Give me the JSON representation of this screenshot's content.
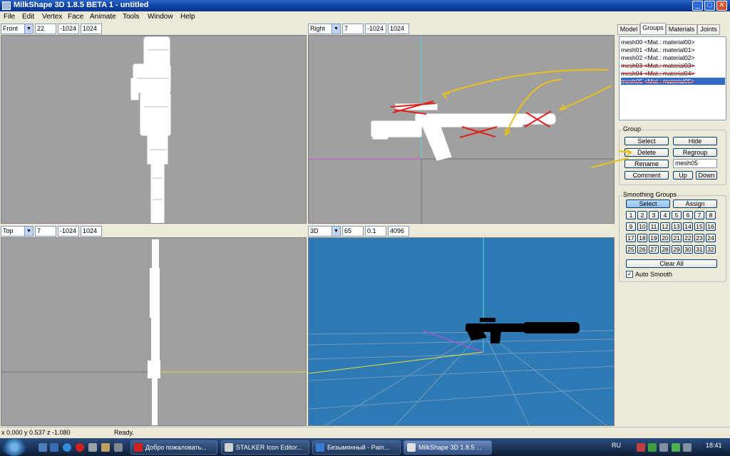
{
  "window": {
    "title": "MilkShape 3D 1.8.5 BETA 1 - untitled",
    "minimize": "_",
    "maximize": "□",
    "close": "✕"
  },
  "menu": [
    "File",
    "Edit",
    "Vertex",
    "Face",
    "Animate",
    "Tools",
    "Window",
    "Help"
  ],
  "viewports": {
    "front": {
      "view": "Front",
      "v1": "22",
      "v2": "-1024",
      "v3": "1024"
    },
    "right": {
      "view": "Right",
      "v1": "7",
      "v2": "-1024",
      "v3": "1024"
    },
    "top": {
      "view": "Top",
      "v1": "7",
      "v2": "-1024",
      "v3": "1024"
    },
    "persp": {
      "view": "3D",
      "v1": "65",
      "v2": "0.1",
      "v3": "4096"
    }
  },
  "tabs": [
    "Model",
    "Groups",
    "Materials",
    "Joints"
  ],
  "groups": [
    {
      "name": "mesh00 <Mat.: material00>",
      "struck": false,
      "selected": false
    },
    {
      "name": "mesh01 <Mat.: material01>",
      "struck": false,
      "selected": false
    },
    {
      "name": "mesh02 <Mat.: material02>",
      "struck": false,
      "selected": false
    },
    {
      "name": "mesh03 <Mat.: material03>",
      "struck": true,
      "selected": false
    },
    {
      "name": "mesh04 <Mat.: material04>",
      "struck": true,
      "selected": false
    },
    {
      "name": "mesh05 <Mat.: material05>",
      "struck": true,
      "selected": true
    }
  ],
  "group_box": {
    "label": "Group",
    "select": "Select",
    "hide": "Hide",
    "delete": "Delete",
    "regroup": "Regroup",
    "rename": "Rename",
    "name_value": "mesh05",
    "comment": "Comment",
    "up": "Up",
    "down": "Down"
  },
  "smoothing": {
    "label": "Smoothing Groups",
    "select": "Select",
    "assign": "Assign",
    "numbers": [
      "1",
      "2",
      "3",
      "4",
      "5",
      "6",
      "7",
      "8",
      "9",
      "10",
      "11",
      "12",
      "13",
      "14",
      "15",
      "16",
      "17",
      "18",
      "19",
      "20",
      "21",
      "22",
      "23",
      "24",
      "25",
      "26",
      "27",
      "28",
      "29",
      "30",
      "31",
      "32"
    ],
    "clear_all": "Clear All",
    "auto_smooth": "Auto Smooth",
    "auto_smooth_checked": true
  },
  "status": {
    "coords": "x 0.000 y 0.537 z -1.080",
    "state": "Ready."
  },
  "taskbar": {
    "tasks": [
      {
        "label": "Добро пожаловать...",
        "color": "#d02020"
      },
      {
        "label": "STALKER Icon Editor...",
        "color": "#d0d0d0"
      },
      {
        "label": "Безымянный - Pain...",
        "color": "#3a7bd5"
      },
      {
        "label": "MilkShape 3D 1.8.5 ...",
        "color": "#e0e0e0"
      }
    ],
    "lang": "RU",
    "time": "18:41"
  },
  "colors": {
    "viewport_bg": "#a0a0a0",
    "persp_bg": "#2e7ab4",
    "selection": "#316ac5",
    "annotation_arrow": "#e8c11a",
    "annotation_cross": "#e0201c"
  }
}
